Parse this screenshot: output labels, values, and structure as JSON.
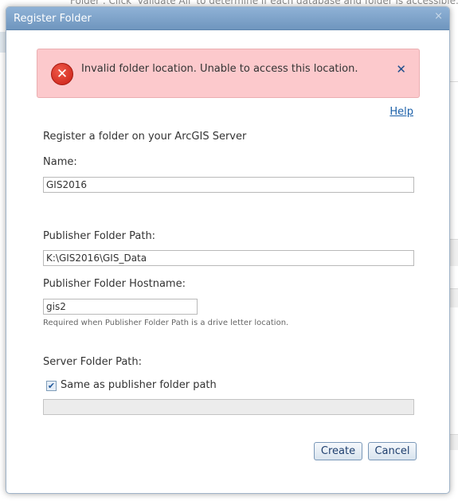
{
  "background": {
    "partial_text": "Folder . Click 'Validate All' to determine if each database and folder is accessible."
  },
  "dialog": {
    "title": "Register Folder",
    "close_glyph": "×"
  },
  "error": {
    "message": "Invalid folder location. Unable to access this location.",
    "icon_glyph": "✕",
    "dismiss_glyph": "✕",
    "icon": "error-circle-icon"
  },
  "help_link": "Help",
  "intro": "Register a folder on your ArcGIS Server",
  "name": {
    "label": "Name:",
    "value": "GIS2016"
  },
  "publisher_path": {
    "label": "Publisher Folder Path:",
    "value": "K:\\GIS2016\\GIS_Data"
  },
  "publisher_hostname": {
    "label": "Publisher Folder Hostname:",
    "value": "gis2",
    "hint": "Required when Publisher Folder Path is a drive letter location."
  },
  "server_path": {
    "label": "Server Folder Path:",
    "checkbox_label": "Same as publisher folder path",
    "checked": true,
    "check_glyph": "✔",
    "value": ""
  },
  "buttons": {
    "create": "Create",
    "cancel": "Cancel"
  },
  "colors": {
    "titlebar": "#7aa0c8",
    "error_bg": "#fcc9cc",
    "link": "#1a5fa8"
  }
}
